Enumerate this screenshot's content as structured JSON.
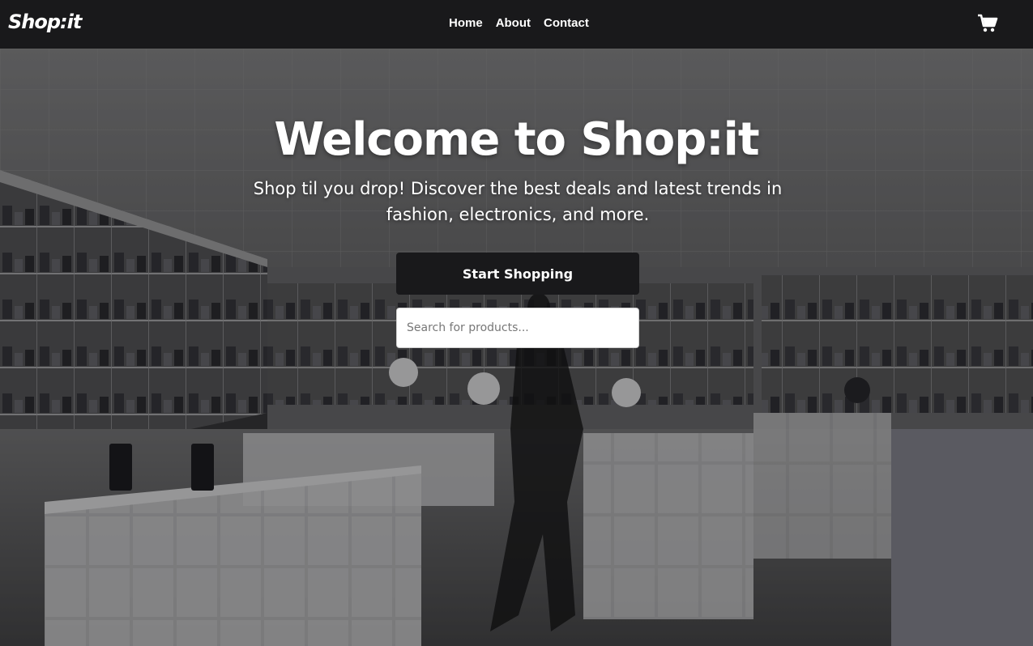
{
  "navbar": {
    "brand": "Shop:it",
    "links": [
      "Home",
      "About",
      "Contact"
    ],
    "cart_icon": "shopping-cart-icon"
  },
  "hero": {
    "title": "Welcome to Shop:it",
    "subtitle": "Shop til you drop! Discover the best deals and latest trends in fashion, electronics, and more.",
    "cta_label": "Start Shopping",
    "search_placeholder": "Search for products...",
    "search_value": ""
  },
  "colors": {
    "navbar_bg": "#19191b",
    "button_bg": "#19191b",
    "text": "#ffffff"
  }
}
